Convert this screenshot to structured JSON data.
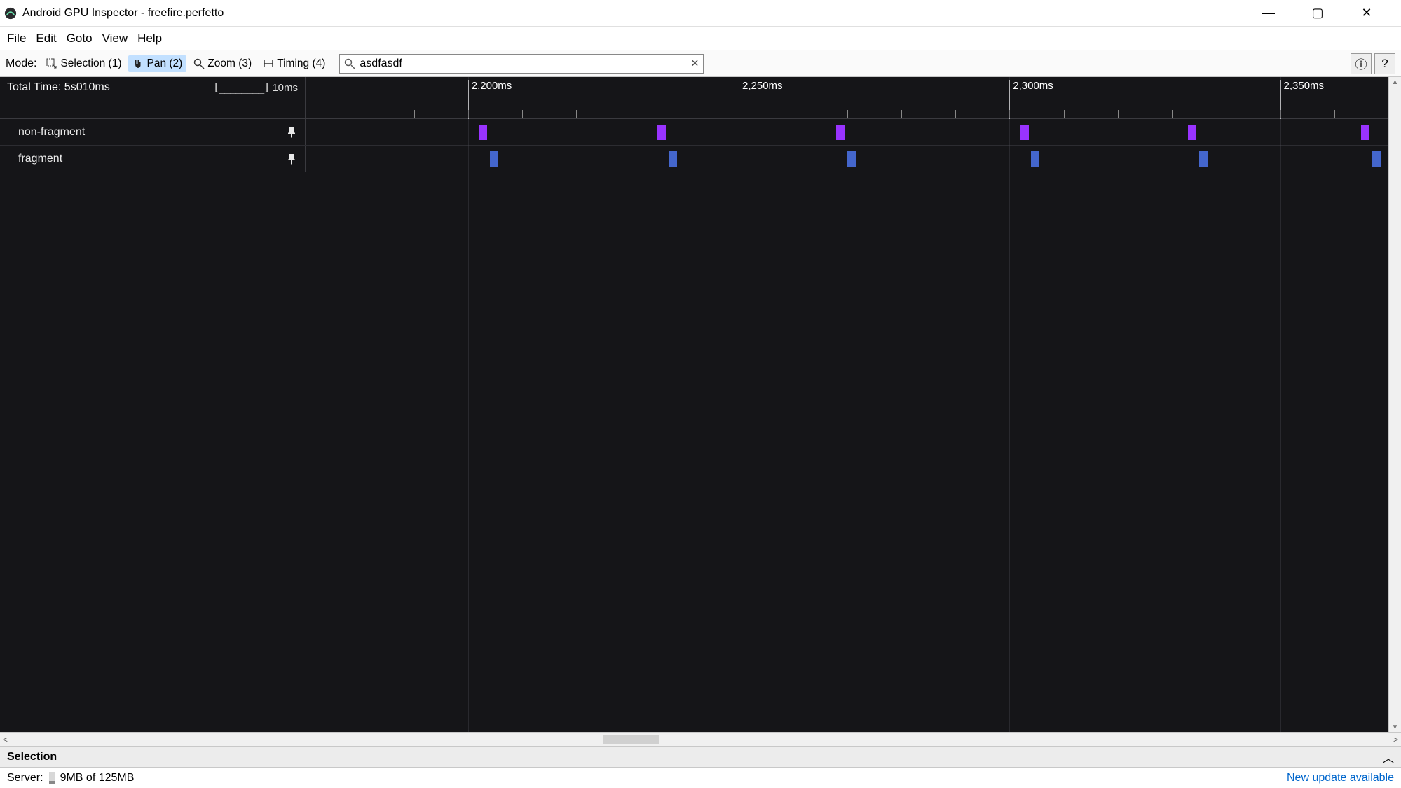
{
  "window": {
    "title": "Android GPU Inspector - freefire.perfetto"
  },
  "menubar": {
    "items": [
      "File",
      "Edit",
      "Goto",
      "View",
      "Help"
    ]
  },
  "toolbar": {
    "mode_label": "Mode:",
    "tools": [
      {
        "label": "Selection (1)",
        "active": false
      },
      {
        "label": "Pan (2)",
        "active": true
      },
      {
        "label": "Zoom (3)",
        "active": false
      },
      {
        "label": "Timing (4)",
        "active": false
      }
    ],
    "search_value": "asdfasdf",
    "help_info": "ⓘ",
    "help_q": "?"
  },
  "timeline": {
    "total_time_label": "Total Time: 5s010ms",
    "scale_label": "10ms",
    "major_ticks_ms": [
      2200,
      2250,
      2300,
      2350
    ],
    "major_tick_labels": [
      "2,200ms",
      "2,250ms",
      "2,300ms",
      "2,350ms"
    ],
    "visible_range_ms": [
      2170,
      2370
    ],
    "tracks": [
      {
        "name": "non-fragment",
        "pinned": true,
        "color": "#9933ff",
        "events_ms": [
          2202,
          2235,
          2268,
          2302,
          2333,
          2365
        ]
      },
      {
        "name": "fragment",
        "pinned": true,
        "color": "#4466cc",
        "events_ms": [
          2204,
          2237,
          2270,
          2304,
          2335,
          2367
        ]
      }
    ]
  },
  "selection_panel": {
    "title": "Selection"
  },
  "statusbar": {
    "server_label": "Server:",
    "memory": "9MB of 125MB",
    "update_link": "New update available"
  }
}
